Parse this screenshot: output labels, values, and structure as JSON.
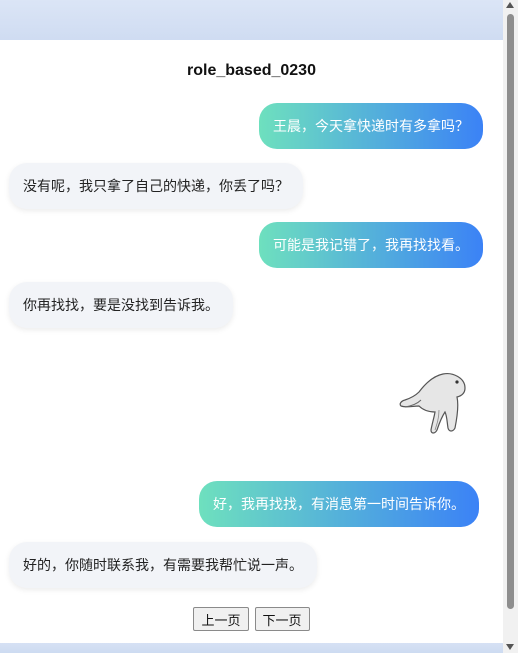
{
  "chat": {
    "title": "role_based_0230",
    "messages": [
      {
        "side": "right",
        "text": "王晨，今天拿快递时有多拿吗？"
      },
      {
        "side": "left",
        "text": "没有呢，我只拿了自己的快递，你丢了吗？"
      },
      {
        "side": "right",
        "text": "可能是我记错了，我再找找看。"
      },
      {
        "side": "left",
        "text": "你再找找，要是没找到告诉我。"
      },
      {
        "side": "right",
        "type": "sticker",
        "icon": "cat-hand-sticker-icon"
      },
      {
        "side": "right",
        "text": "好，我再找找，有消息第一时间告诉你。"
      },
      {
        "side": "left",
        "text": "好的，你随时联系我，有需要我帮忙说一声。"
      }
    ]
  },
  "pager": {
    "prev_label": "上一页",
    "next_label": "下一页"
  },
  "colors": {
    "bubble_gradient_start": "#6ee0be",
    "bubble_gradient_end": "#3b82f6",
    "left_bubble_bg": "#f2f4f8"
  }
}
